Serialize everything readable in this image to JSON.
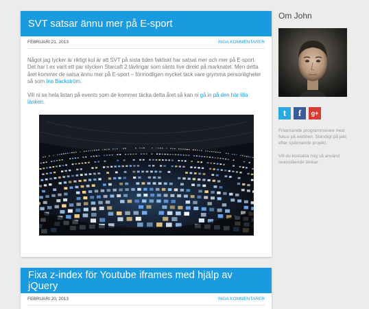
{
  "posts": [
    {
      "title": "SVT satsar ännu mer på E-sport",
      "date": "FEBRUARI 21, 2013",
      "comments": "INGA KOMMENTARER",
      "body1": "Något jag tycker är riktigt kul är att SVT på sista tiden faktiskt har satsat mer och mer på E-sport. Det har t.ex varit ett par stycken Starcaft 2 tävlingar som sänts live direkt på marknatet. Men detta året kommer de satsa ännu mer på E-sport – förmodligen mycket tack vare grymma personligheter så som ",
      "body1_link": "Ina Backström",
      "body1_end": ".",
      "body2": "Vill ni se hela listan på events som de kommer täcka detta året så kan ni ",
      "body2_link": "gå in på den här lilla länken",
      "body2_end": "."
    },
    {
      "title": "Fixa z-index för Youtube iframes med hjälp av jQuery",
      "date": "FEBRUARI 20, 2013",
      "comments": "INGA KOMMENTARER"
    }
  ],
  "sidebar": {
    "title": "Om John",
    "about": "Frilansande programmerare med fokus på webben. Ständigt på jakt efter spännande projekt.",
    "contact": "Vill du kontakta mig så använd ovanstående länkar.",
    "social": [
      {
        "name": "twitter",
        "glyph": "t",
        "color": "#2aa9e0"
      },
      {
        "name": "facebook",
        "glyph": "f",
        "color": "#3b5b99"
      },
      {
        "name": "google-plus",
        "glyph": "g+",
        "color": "#d73d32"
      }
    ]
  },
  "colors": {
    "accent": "#1a9be0",
    "background": "#ececec"
  }
}
